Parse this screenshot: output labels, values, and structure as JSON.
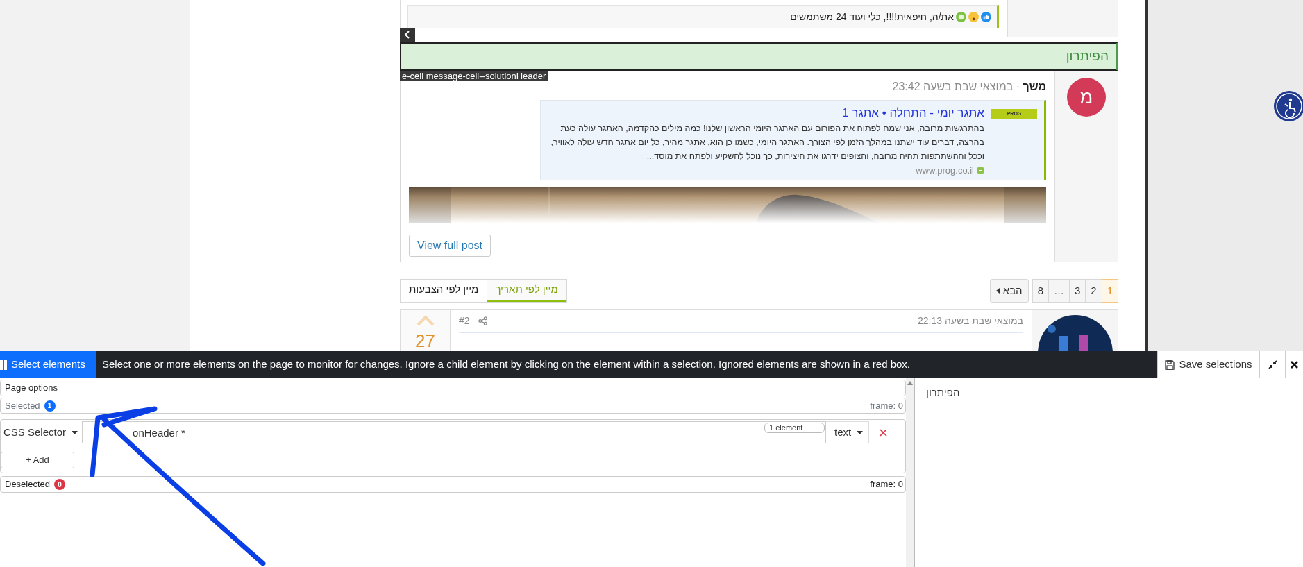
{
  "forum": {
    "reactions": {
      "text": "את/ה, חיפאית!!!!, כלי ועוד 24 משתמשים"
    },
    "solution_header": "הפיתרון",
    "inspector_label": "e-cell message-cell--solutionHeader",
    "post": {
      "avatar_letter": "מ",
      "author": "משך",
      "time": "· במוצאי שבת בשעה 23:42",
      "link_preview": {
        "title": "אתגר יומי - התחלה • אתגר 1",
        "logo": "PROG",
        "description": "בהתרגשות מרובה, אני שמח לפתוח את הפורום עם האתגר היומי הראשון שלנו! כמה מילים כהקדמה, האתגר עולה כעת בהרצה, דברים עוד ישתנו במהלך הזמן לפי הצורך. האתגר היומי, כשמו כן הוא, אתגר מהיר, כל יום אתגר חדש עולה לאוויר, וככל וההשתתפות תהיה מרובה, והצופים ידרגו את היצירות, כך נוכל להשקיע ולפתח את מוסד...",
        "domain": "www.prog.co.il"
      },
      "button": "View full post"
    },
    "sort_tabs": [
      {
        "label": "מיין לפי תאריך",
        "selected": true
      },
      {
        "label": "מיין לפי הצבעות",
        "selected": false
      }
    ],
    "pagination": {
      "next": "הבא",
      "pages": [
        {
          "label": "1",
          "selected": true
        },
        {
          "label": "2",
          "selected": false
        },
        {
          "label": "3",
          "selected": false
        },
        {
          "label": "…",
          "selected": false
        },
        {
          "label": "8",
          "selected": false
        }
      ]
    },
    "next_post": {
      "votes": "27",
      "number": "#2",
      "time": "במוצאי שבת בשעה 22:13"
    }
  },
  "panel": {
    "select_button": "Select elements",
    "message": "Select one or more elements on the page to monitor for changes. Ignore a child element by clicking on the element within a selection. Ignored elements are shown in a red box.",
    "save_button": "Save selections",
    "page_options": "Page options",
    "selected": {
      "label": "Selected",
      "count": "1",
      "color": "#0d6efd",
      "frame": "frame: 0"
    },
    "selector": {
      "type": "CSS Selector",
      "value": "onHeader *",
      "match_count": "1 element",
      "mode": "text"
    },
    "add_button": "+ Add",
    "deselected": {
      "label": "Deselected",
      "count": "0",
      "color": "#dc3545",
      "frame": "frame: 0"
    },
    "preview_text": "הפיתרון"
  }
}
